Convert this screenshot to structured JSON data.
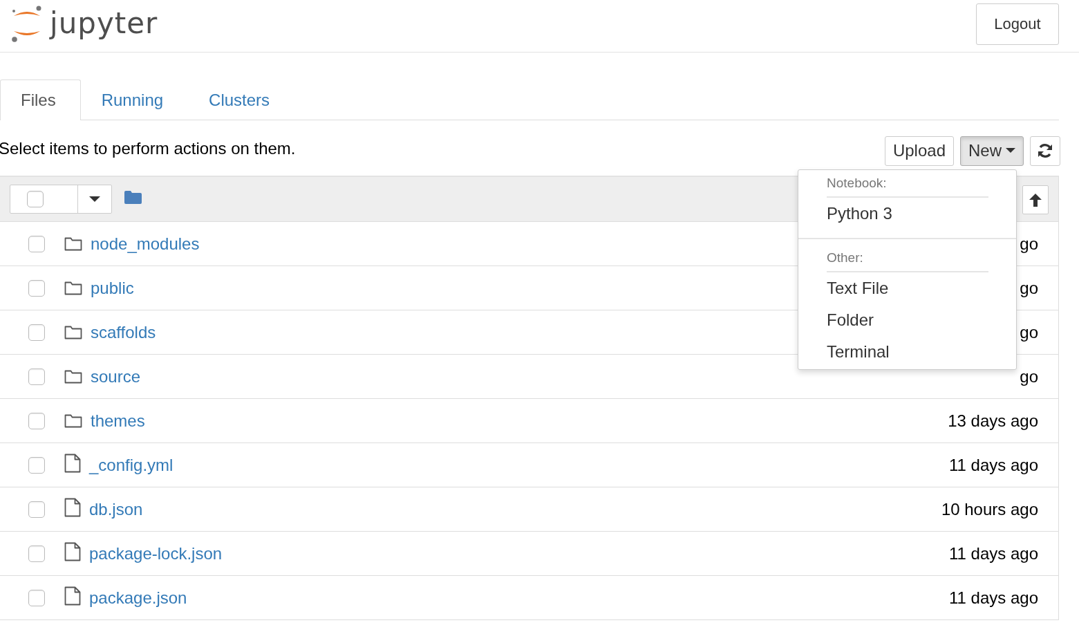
{
  "header": {
    "logo_text": "jupyter",
    "logout": "Logout"
  },
  "tabs": [
    {
      "label": "Files",
      "selected": true
    },
    {
      "label": "Running",
      "selected": false
    },
    {
      "label": "Clusters",
      "selected": false
    }
  ],
  "toolbar": {
    "hint": "Select items to perform actions on them.",
    "buttons": [
      {
        "kind": "plain",
        "label": "Upload"
      },
      {
        "kind": "dropdown",
        "label": "New",
        "expanded": true
      },
      {
        "kind": "refresh"
      }
    ]
  },
  "list_header": {
    "select_all_checked": false
  },
  "items": [
    {
      "kind": "folder",
      "name": "node_modules",
      "modified": "go",
      "checked": false
    },
    {
      "kind": "folder",
      "name": "public",
      "modified": "go",
      "checked": false
    },
    {
      "kind": "folder",
      "name": "scaffolds",
      "modified": "go",
      "checked": false
    },
    {
      "kind": "folder",
      "name": "source",
      "modified": "go",
      "checked": false
    },
    {
      "kind": "folder",
      "name": "themes",
      "modified": "13 days ago",
      "checked": false
    },
    {
      "kind": "file",
      "name": "_config.yml",
      "modified": "11 days ago",
      "checked": false
    },
    {
      "kind": "file",
      "name": "db.json",
      "modified": "10 hours ago",
      "checked": false
    },
    {
      "kind": "file",
      "name": "package-lock.json",
      "modified": "11 days ago",
      "checked": false
    },
    {
      "kind": "file",
      "name": "package.json",
      "modified": "11 days ago",
      "checked": false
    }
  ],
  "new_menu": {
    "sections": [
      {
        "heading": "Notebook:",
        "items": [
          "Python 3"
        ]
      },
      {
        "heading": "Other:",
        "items": [
          "Text File",
          "Folder",
          "Terminal"
        ]
      }
    ]
  }
}
